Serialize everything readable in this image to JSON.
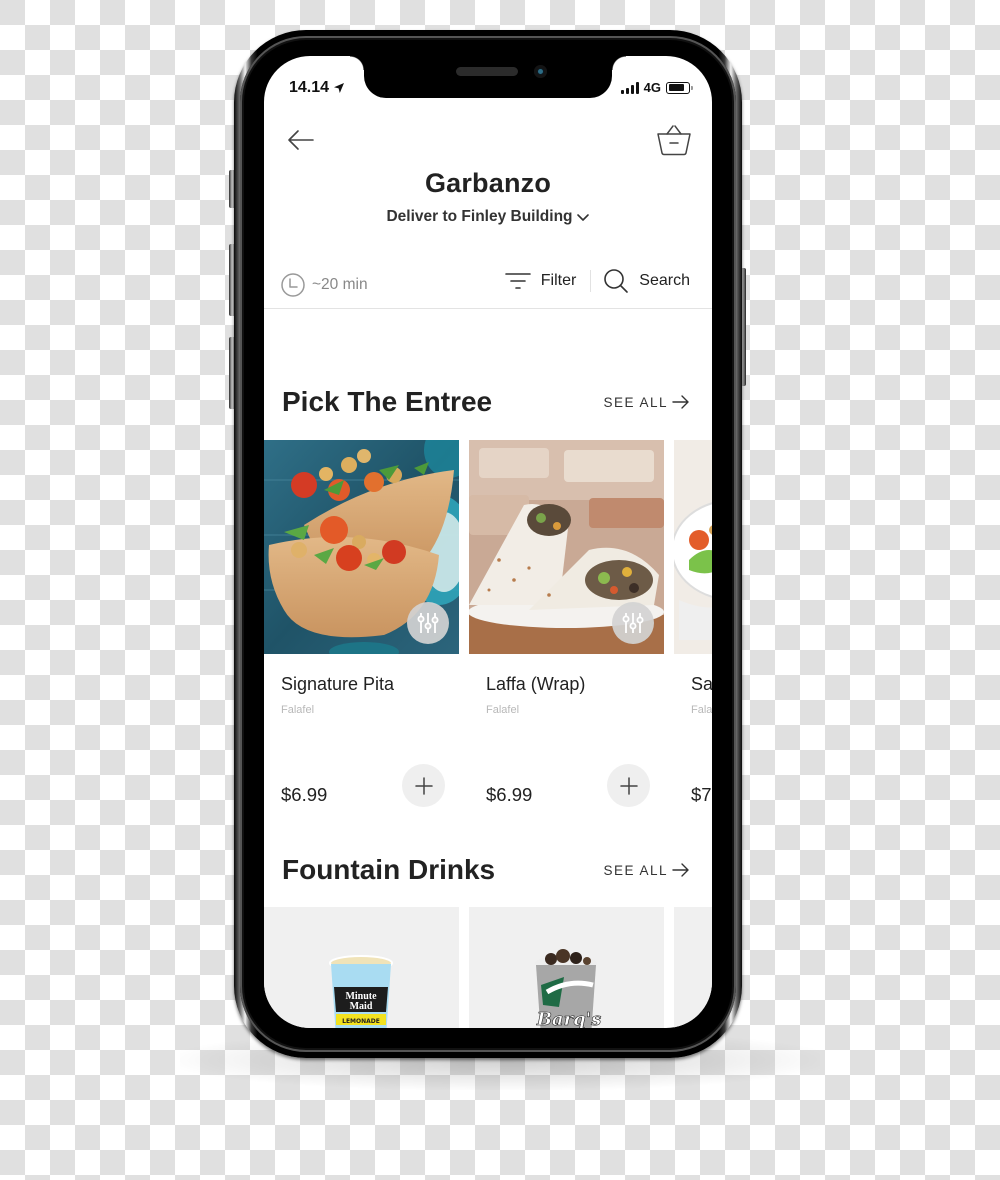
{
  "status_bar": {
    "time": "14.14",
    "network": "4G",
    "location_icon": "location-arrow-icon",
    "signal_icon": "signal-bars-icon",
    "battery_icon": "battery-icon",
    "battery_level": 0.8
  },
  "header": {
    "back_icon": "arrow-left-icon",
    "cart_icon": "basket-icon",
    "restaurant_name": "Garbanzo",
    "deliver_to": "Deliver to Finley Building",
    "deliver_icon": "chevron-down-icon"
  },
  "toolbar": {
    "eta": "~20 min",
    "eta_icon": "clock-icon",
    "filter_label": "Filter",
    "filter_icon": "filter-icon",
    "search_label": "Search",
    "search_icon": "search-icon"
  },
  "sections": [
    {
      "title": "Pick The Entree",
      "see_all": "SEE ALL",
      "see_all_icon": "arrow-right-icon",
      "items": [
        {
          "name": "Signature Pita",
          "subtitle": "Falafel",
          "price": "$6.99",
          "image": "pita-sandwich-photo",
          "customize_icon": "sliders-icon",
          "add_icon": "plus-icon"
        },
        {
          "name": "Laffa (Wrap)",
          "subtitle": "Falafel",
          "price": "$6.99",
          "image": "wrap-photo",
          "customize_icon": "sliders-icon",
          "add_icon": "plus-icon"
        },
        {
          "name": "Sa",
          "subtitle": "Fala",
          "price": "$7",
          "image": "salad-bowl-photo",
          "customize_icon": "sliders-icon",
          "add_icon": "plus-icon"
        }
      ]
    },
    {
      "title": "Fountain Drinks",
      "see_all": "SEE ALL",
      "see_all_icon": "arrow-right-icon",
      "items": [
        {
          "image": "minute-maid-lemonade-cup",
          "brand_line1": "Minute",
          "brand_line2": "Maid",
          "label": "LEMONADE"
        },
        {
          "image": "barqs-root-beer-cup",
          "brand": "Barq's"
        },
        {
          "image": "drink-cup"
        }
      ]
    }
  ],
  "colors": {
    "text_primary": "#222222",
    "text_muted": "#888888",
    "text_subtle": "#b8b8b8",
    "button_bg": "#efefef",
    "divider": "#e3e3e3"
  }
}
